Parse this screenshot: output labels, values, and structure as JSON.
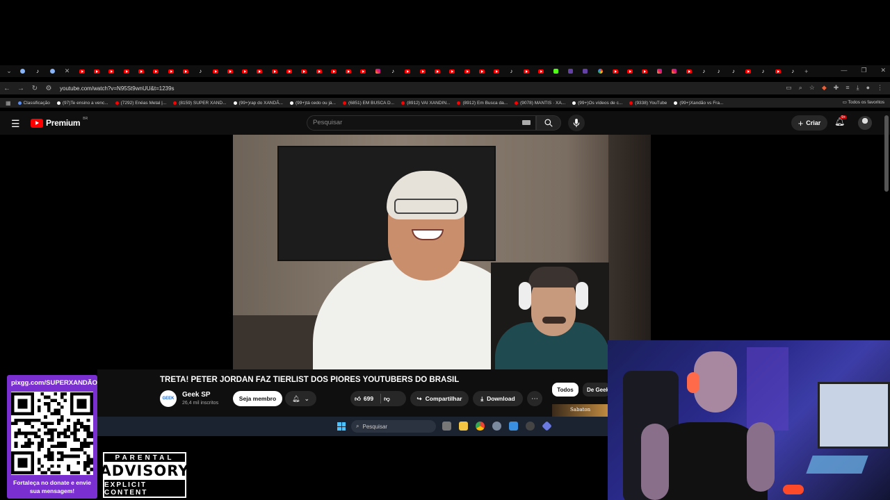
{
  "browser": {
    "url": "youtube.com/watch?v=N95St9wnUU&t=1239s",
    "bookmarks": [
      {
        "label": "Classificação",
        "icon": "blue"
      },
      {
        "label": "(97)Te ensino a venc...",
        "icon": "tt"
      },
      {
        "label": "(7292) Enéas Metal |...",
        "icon": "yt"
      },
      {
        "label": "(8159) SUPER XAND...",
        "icon": "yt"
      },
      {
        "label": "(99+)rap do XANDÃ...",
        "icon": "tt"
      },
      {
        "label": "(99+)tá cedo ou já...",
        "icon": "tt"
      },
      {
        "label": "(6851) EM BUSCA D...",
        "icon": "yt"
      },
      {
        "label": "(8912) VAI XANDIN...",
        "icon": "yt"
      },
      {
        "label": "(8912) Em Busca da...",
        "icon": "yt"
      },
      {
        "label": "(9078) MANTIS · XA...",
        "icon": "yt"
      },
      {
        "label": "(99+)Os vídeos de c...",
        "icon": "tt"
      },
      {
        "label": "(9338) YouTube",
        "icon": "yt"
      },
      {
        "label": "(99+)Xandão vs Fra...",
        "icon": "tt"
      }
    ],
    "all_favorites": "Todos os favoritos"
  },
  "youtube": {
    "brand": "Premium",
    "country_code": "BR",
    "search_placeholder": "Pesquisar",
    "create_label": "Criar",
    "notifications_badge": "9+",
    "video": {
      "title": "TRETA! PETER JORDAN FAZ TIERLIST DOS PIORES YOUTUBERS DO BRASIL",
      "channel_name": "Geek SP",
      "channel_avatar_text": "GEEK",
      "subscribers": "26,4 mil inscritos",
      "join_label": "Seja membro",
      "likes": "699",
      "share_label": "Compartilhar",
      "download_label": "Download"
    },
    "chips": [
      "Todos",
      "De Geek SP"
    ],
    "thumb_text": "Sabaton"
  },
  "taskbar": {
    "search_placeholder": "Pesquisar"
  },
  "overlay": {
    "qr_link": "pixgg.com/SUPERXANDÃO",
    "qr_message": "Fortaleça no donate e envie sua mensagem!",
    "advisory_top": "PARENTAL",
    "advisory_mid": "ADVISORY",
    "advisory_bot": "EXPLICIT CONTENT"
  },
  "colors": {
    "youtube_red": "#ff0000",
    "qr_panel": "#7a2fd0",
    "taskbar": "#1c2330"
  }
}
